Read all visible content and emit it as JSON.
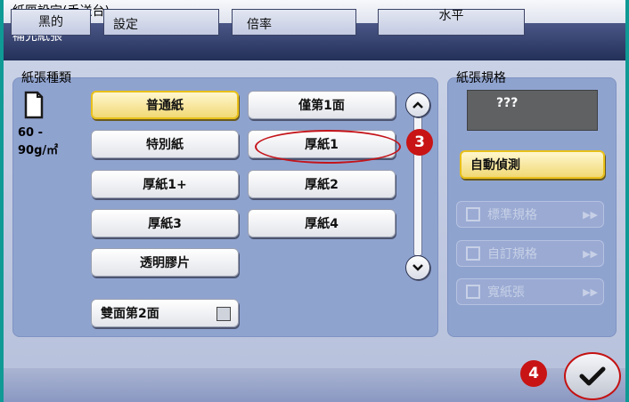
{
  "header": {
    "title": "紙匣設定(手送台)",
    "subtitle": "補充紙張"
  },
  "paper_type": {
    "title": "紙張種類",
    "weight_line1": "60 -",
    "weight_line2": "90g/㎡",
    "buttons": {
      "plain": "普通紙",
      "single_side": "僅第1面",
      "special": "特別紙",
      "thick1": "厚紙1",
      "thick1plus": "厚紙1+",
      "thick2": "厚紙2",
      "thick3": "厚紙3",
      "thick4": "厚紙4",
      "transparency": "透明膠片",
      "duplex_side2": "雙面第2面"
    }
  },
  "paper_size": {
    "title": "紙張規格",
    "display": "???",
    "auto": "自動偵測",
    "standard": "標準規格",
    "custom": "自訂規格",
    "wide": "寬紙張"
  },
  "annotations": {
    "step3": "3",
    "step4": "4"
  },
  "bottom_tabs": {
    "black": "黑的",
    "setting": "設定",
    "magnification": "倍率",
    "horizontal": "水平"
  },
  "colors": {
    "selected": "#f1d975",
    "annotation": "#c81414",
    "panel": "#8fa3cf"
  }
}
